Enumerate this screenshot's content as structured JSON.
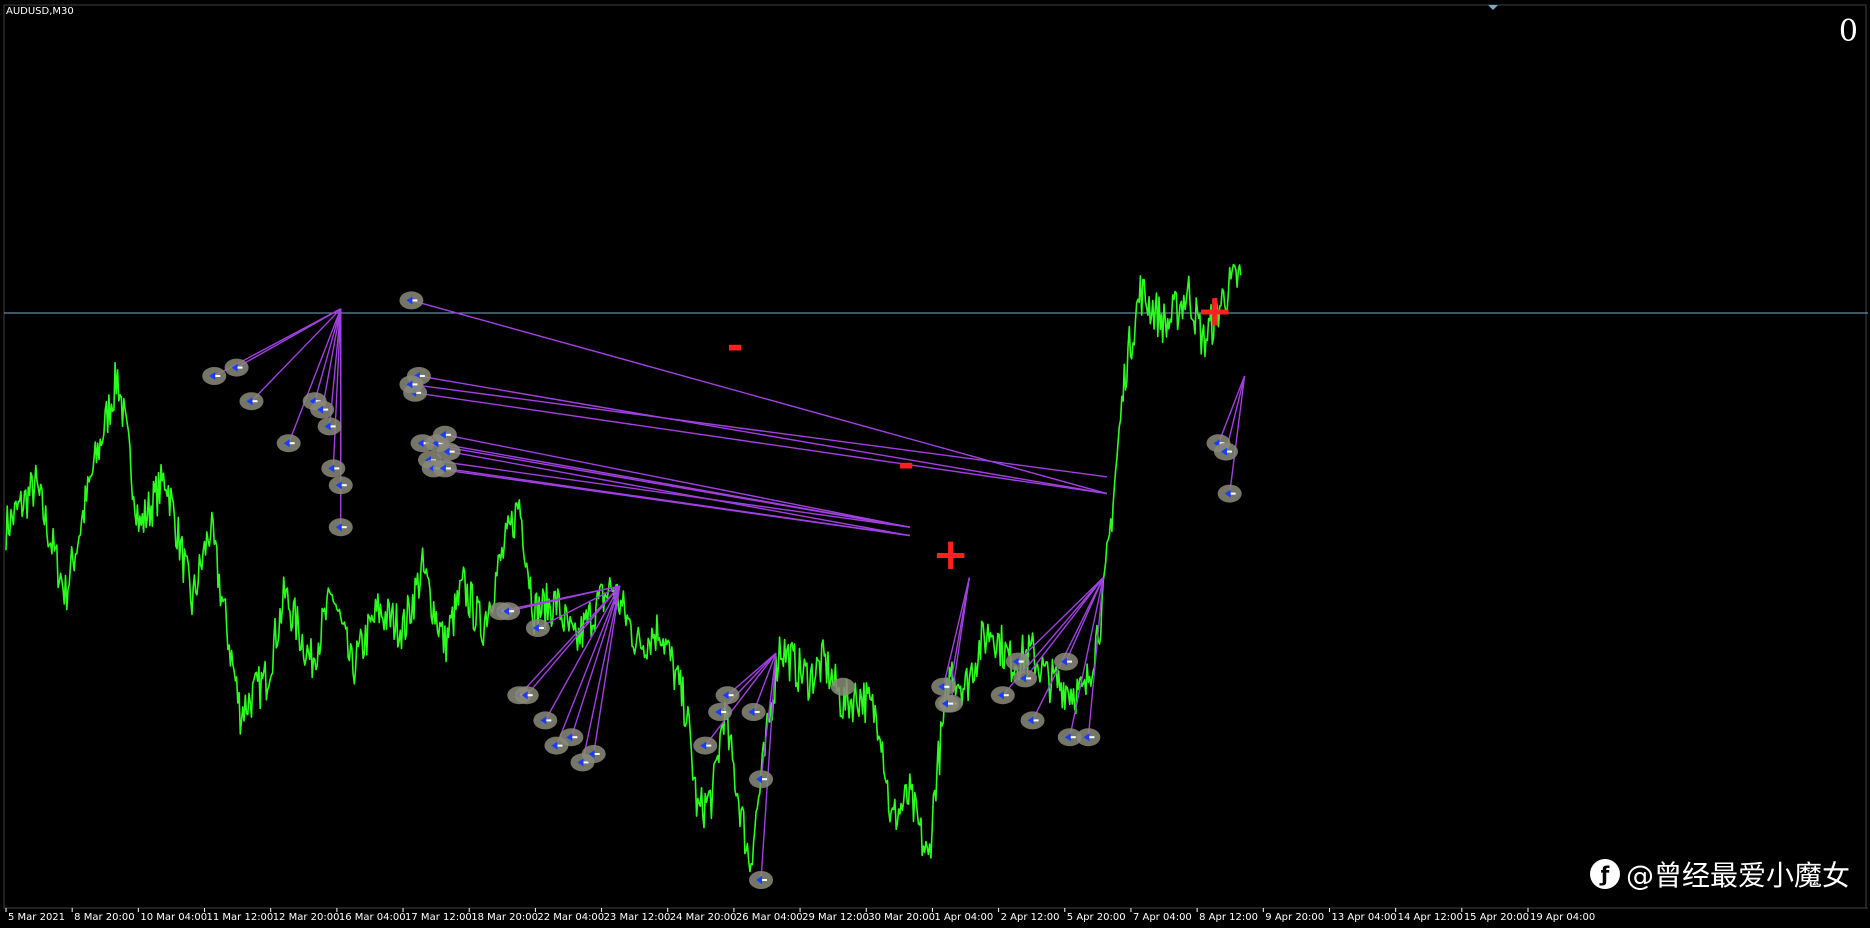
{
  "window": {
    "symbol_label": "AUDUSD,M30",
    "corner_counter": "0",
    "watermark": "@曾经最爱小魔女"
  },
  "colors": {
    "background": "#000000",
    "price_line": "#2bff1e",
    "signal_line": "#a040e0",
    "marker_fill": "#8a8a7a",
    "sign_color": "#ff2020",
    "level_line": "#7aa9c9",
    "axis_text": "#ffffff"
  },
  "chart_data": {
    "type": "line",
    "symbol": "AUDUSD",
    "timeframe": "M30",
    "grid": false,
    "x_ticks": [
      "5 Mar 2021",
      "8 Mar 20:00",
      "10 Mar 04:00",
      "11 Mar 12:00",
      "12 Mar 20:00",
      "16 Mar 04:00",
      "17 Mar 12:00",
      "18 Mar 20:00",
      "22 Mar 04:00",
      "23 Mar 12:00",
      "24 Mar 20:00",
      "26 Mar 04:00",
      "29 Mar 12:00",
      "30 Mar 20:00",
      "1 Apr 04:00",
      "2 Apr 12:00",
      "5 Apr 20:00",
      "7 Apr 04:00",
      "8 Apr 12:00",
      "9 Apr 20:00",
      "13 Apr 04:00",
      "14 Apr 12:00",
      "15 Apr 20:00",
      "19 Apr 04:00"
    ],
    "price_anchors": [
      [
        0,
        0.42
      ],
      [
        0.8,
        0.47
      ],
      [
        1.6,
        0.34
      ],
      [
        2.3,
        0.48
      ],
      [
        3.0,
        0.6
      ],
      [
        3.6,
        0.42
      ],
      [
        4.3,
        0.48
      ],
      [
        5.0,
        0.33
      ],
      [
        5.5,
        0.42
      ],
      [
        6.3,
        0.2
      ],
      [
        7.0,
        0.24
      ],
      [
        7.5,
        0.34
      ],
      [
        8.2,
        0.26
      ],
      [
        8.8,
        0.34
      ],
      [
        9.3,
        0.25
      ],
      [
        10.0,
        0.32
      ],
      [
        10.7,
        0.3
      ],
      [
        11.2,
        0.37
      ],
      [
        11.8,
        0.28
      ],
      [
        12.3,
        0.35
      ],
      [
        12.8,
        0.3
      ],
      [
        13.3,
        0.38
      ],
      [
        13.8,
        0.45
      ],
      [
        14.2,
        0.32
      ],
      [
        14.8,
        0.33
      ],
      [
        15.3,
        0.28
      ],
      [
        15.8,
        0.32
      ],
      [
        16.3,
        0.35
      ],
      [
        17.0,
        0.28
      ],
      [
        17.6,
        0.3
      ],
      [
        18.3,
        0.2
      ],
      [
        18.6,
        0.08
      ],
      [
        19.0,
        0.1
      ],
      [
        19.3,
        0.2
      ],
      [
        20.0,
        0.02
      ],
      [
        20.8,
        0.28
      ],
      [
        21.3,
        0.25
      ],
      [
        21.6,
        0.24
      ],
      [
        22.0,
        0.26
      ],
      [
        22.5,
        0.21
      ],
      [
        23.0,
        0.22
      ],
      [
        23.5,
        0.19
      ],
      [
        23.8,
        0.07
      ],
      [
        24.3,
        0.1
      ],
      [
        24.8,
        0.02
      ],
      [
        25.0,
        0.12
      ],
      [
        25.4,
        0.25
      ],
      [
        25.8,
        0.23
      ],
      [
        26.2,
        0.28
      ],
      [
        26.5,
        0.3
      ],
      [
        27.0,
        0.26
      ],
      [
        27.6,
        0.27
      ],
      [
        28.0,
        0.24
      ],
      [
        28.5,
        0.23
      ],
      [
        29.0,
        0.22
      ],
      [
        29.5,
        0.33
      ],
      [
        30.1,
        0.61
      ],
      [
        30.5,
        0.7
      ],
      [
        31.2,
        0.66
      ],
      [
        31.8,
        0.7
      ],
      [
        32.2,
        0.64
      ],
      [
        32.8,
        0.7
      ],
      [
        33.2,
        0.72
      ]
    ],
    "y_lines": [
      0.675
    ],
    "signs": [
      {
        "text": "-",
        "at": [
          19.6,
          0.62
        ]
      },
      {
        "text": "-",
        "at": [
          24.2,
          0.48
        ]
      },
      {
        "text": "+",
        "at": [
          25.4,
          0.37
        ]
      },
      {
        "text": "+",
        "at": [
          32.5,
          0.66
        ]
      }
    ],
    "signal_fans": [
      {
        "apex": [
          9.0,
          0.68
        ],
        "points": [
          [
            5.6,
            0.6
          ],
          [
            6.2,
            0.61
          ],
          [
            6.6,
            0.57
          ],
          [
            7.6,
            0.52
          ],
          [
            8.3,
            0.57
          ],
          [
            8.5,
            0.56
          ],
          [
            8.7,
            0.54
          ],
          [
            8.8,
            0.49
          ],
          [
            9.0,
            0.47
          ],
          [
            9.0,
            0.42
          ]
        ]
      },
      {
        "apex": [
          29.6,
          0.46
        ],
        "points": [
          [
            10.9,
            0.69
          ],
          [
            11.1,
            0.6
          ],
          [
            11.0,
            0.58
          ]
        ]
      },
      {
        "apex": [
          29.6,
          0.48
        ],
        "points": [
          [
            10.9,
            0.59
          ]
        ]
      },
      {
        "apex": [
          24.3,
          0.42
        ],
        "points": [
          [
            11.2,
            0.52
          ],
          [
            11.6,
            0.52
          ],
          [
            11.8,
            0.53
          ],
          [
            11.4,
            0.5
          ]
        ]
      },
      {
        "apex": [
          24.3,
          0.41
        ],
        "points": [
          [
            11.9,
            0.51
          ],
          [
            11.5,
            0.49
          ],
          [
            11.8,
            0.49
          ]
        ]
      },
      {
        "apex": [
          16.5,
          0.35
        ],
        "points": [
          [
            13.3,
            0.32
          ],
          [
            13.5,
            0.32
          ],
          [
            14.3,
            0.3
          ],
          [
            13.8,
            0.22
          ],
          [
            14.0,
            0.22
          ],
          [
            14.5,
            0.19
          ],
          [
            14.8,
            0.16
          ],
          [
            15.2,
            0.17
          ],
          [
            15.5,
            0.14
          ],
          [
            15.8,
            0.15
          ]
        ]
      },
      {
        "apex": [
          20.7,
          0.27
        ],
        "points": [
          [
            18.8,
            0.16
          ],
          [
            19.4,
            0.22
          ],
          [
            19.2,
            0.2
          ],
          [
            20.1,
            0.2
          ],
          [
            20.3,
            0.12
          ],
          [
            20.3,
            0.0
          ]
        ]
      },
      {
        "apex": [
          25.9,
          0.36
        ],
        "points": [
          [
            25.2,
            0.23
          ],
          [
            25.4,
            0.21
          ],
          [
            25.3,
            0.21
          ]
        ]
      },
      {
        "apex": [
          29.5,
          0.36
        ],
        "points": [
          [
            26.8,
            0.22
          ],
          [
            27.2,
            0.26
          ],
          [
            27.4,
            0.24
          ],
          [
            27.6,
            0.19
          ],
          [
            28.6,
            0.17
          ],
          [
            29.1,
            0.17
          ],
          [
            28.5,
            0.26
          ]
        ]
      },
      {
        "apex": [
          33.3,
          0.6
        ],
        "points": [
          [
            32.6,
            0.52
          ],
          [
            32.8,
            0.51
          ],
          [
            32.9,
            0.46
          ]
        ]
      }
    ],
    "standalone_markers": [
      [
        22.5,
        0.23
      ]
    ]
  }
}
